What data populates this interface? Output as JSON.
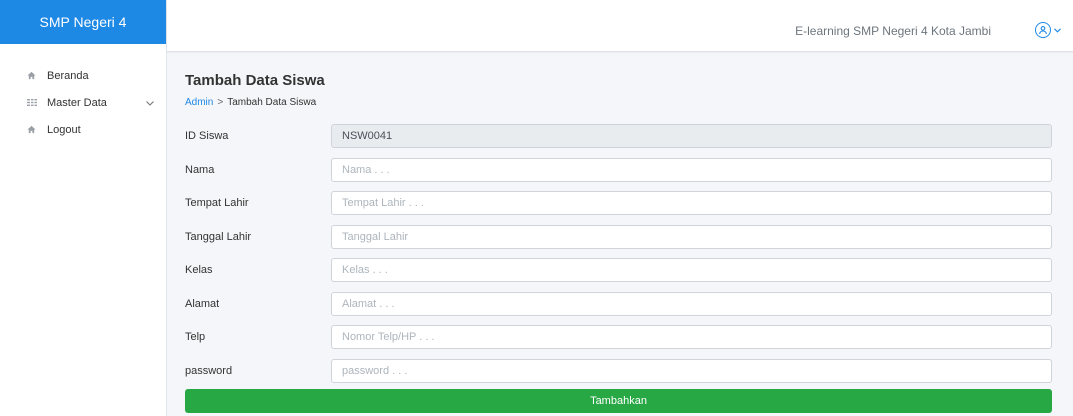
{
  "sidebar": {
    "brand": "SMP Negeri 4",
    "items": [
      {
        "label": "Beranda",
        "icon": "home-icon"
      },
      {
        "label": "Master Data",
        "icon": "grid-icon"
      },
      {
        "label": "Logout",
        "icon": "home-icon"
      }
    ]
  },
  "topbar": {
    "title": "E-learning SMP Negeri 4 Kota Jambi",
    "user_icon": "user-circle-icon"
  },
  "page": {
    "title": "Tambah Data Siswa",
    "breadcrumb": {
      "root": "Admin",
      "separator": ">",
      "current": "Tambah Data Siswa"
    }
  },
  "form": {
    "fields": [
      {
        "label": "ID Siswa",
        "value": "NSW0041",
        "placeholder": ""
      },
      {
        "label": "Nama",
        "value": "",
        "placeholder": "Nama . . ."
      },
      {
        "label": "Tempat Lahir",
        "value": "",
        "placeholder": "Tempat Lahir . . ."
      },
      {
        "label": "Tanggal Lahir",
        "value": "",
        "placeholder": "Tanggal Lahir"
      },
      {
        "label": "Kelas",
        "value": "",
        "placeholder": "Kelas . . ."
      },
      {
        "label": "Alamat",
        "value": "",
        "placeholder": "Alamat . . ."
      },
      {
        "label": "Telp",
        "value": "",
        "placeholder": "Nomor Telp/HP . . ."
      },
      {
        "label": "password",
        "value": "",
        "placeholder": "password . . ."
      }
    ],
    "submit_label": "Tambahkan"
  },
  "colors": {
    "brand": "#1e88e5",
    "submit": "#28a745",
    "background": "#f4f6f9"
  }
}
